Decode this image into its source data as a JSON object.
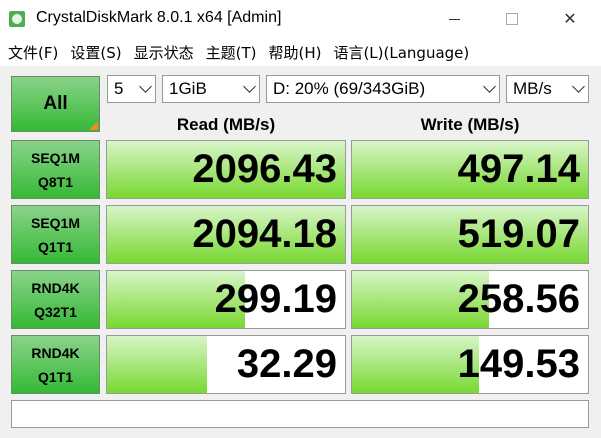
{
  "window": {
    "title": "CrystalDiskMark 8.0.1 x64 [Admin]",
    "controls": {
      "minimize": "",
      "maximize": "",
      "close": "✕"
    }
  },
  "menu": [
    {
      "label": "文件(F)"
    },
    {
      "label": "设置(S)"
    },
    {
      "label": "显示状态"
    },
    {
      "label": "主题(T)"
    },
    {
      "label": "帮助(H)"
    },
    {
      "label": "语言(L)(Language)"
    }
  ],
  "controls": {
    "all_button": "All",
    "count_select": "5",
    "size_select": "1GiB",
    "drive_select": "D: 20% (69/343GiB)",
    "unit_select": "MB/s"
  },
  "headers": {
    "read": "Read (MB/s)",
    "write": "Write (MB/s)"
  },
  "tests": [
    {
      "line1": "SEQ1M",
      "line2": "Q8T1",
      "read": "2096.43",
      "write": "497.14",
      "read_fill": 1.0,
      "write_fill": 1.0
    },
    {
      "line1": "SEQ1M",
      "line2": "Q1T1",
      "read": "2094.18",
      "write": "519.07",
      "read_fill": 1.0,
      "write_fill": 1.0
    },
    {
      "line1": "RND4K",
      "line2": "Q32T1",
      "read": "299.19",
      "write": "258.56",
      "read_fill": 0.58,
      "write_fill": 0.58
    },
    {
      "line1": "RND4K",
      "line2": "Q1T1",
      "read": "32.29",
      "write": "149.53",
      "read_fill": 0.42,
      "write_fill": 0.54
    }
  ],
  "comment": "",
  "colors": {
    "button_green": "#35b935",
    "bar_green": "#78d830",
    "corner_orange": "#f08a24"
  }
}
